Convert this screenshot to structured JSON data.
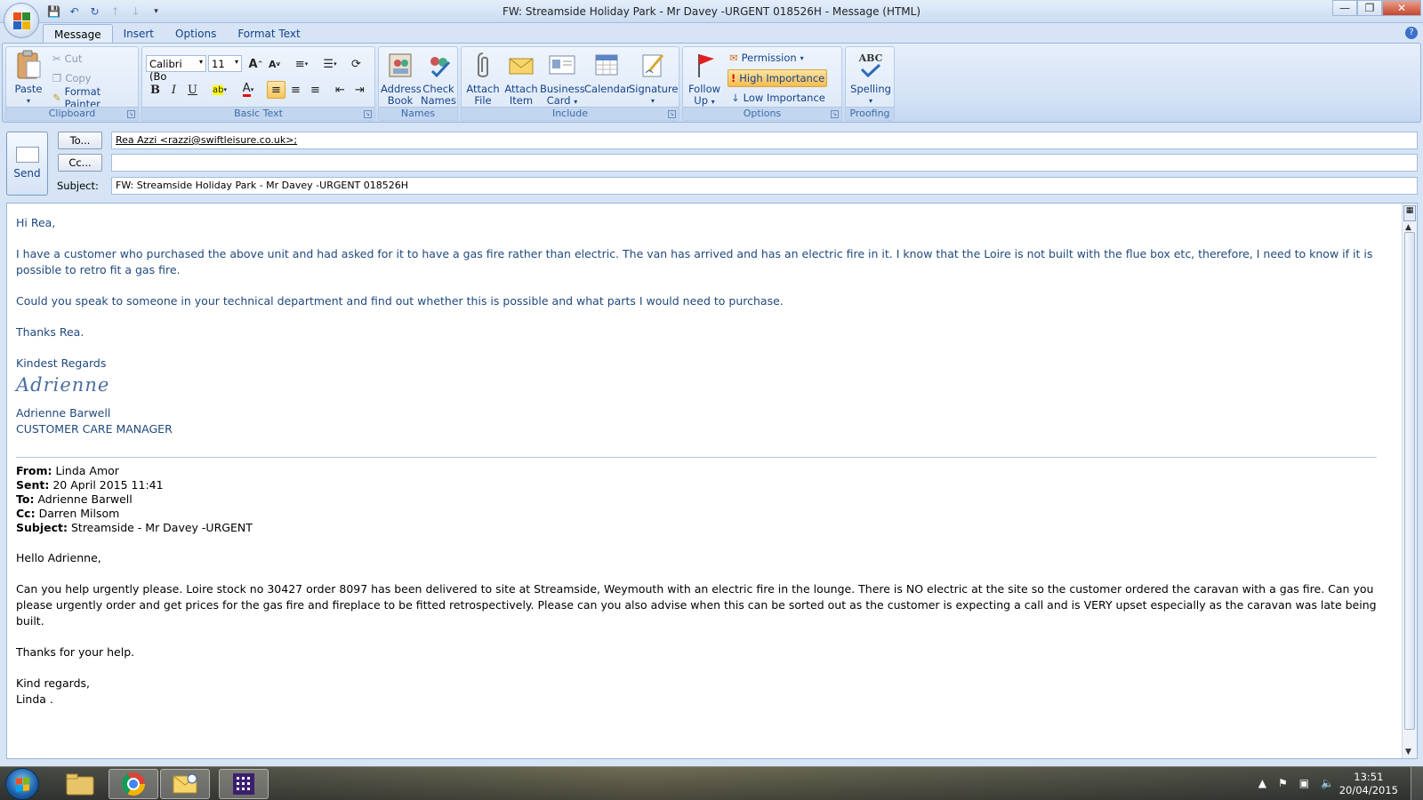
{
  "window": {
    "title": "FW: Streamside Holiday Park  - Mr Davey -URGENT 018526H - Message (HTML)"
  },
  "tabs": [
    "Message",
    "Insert",
    "Options",
    "Format Text"
  ],
  "ribbon": {
    "clipboard": {
      "label": "Clipboard",
      "paste": "Paste",
      "cut": "Cut",
      "copy": "Copy",
      "format_painter": "Format Painter"
    },
    "basic_text": {
      "label": "Basic Text",
      "font": "Calibri (Bo",
      "size": "11"
    },
    "names": {
      "label": "Names",
      "address_book": [
        "Address",
        "Book"
      ],
      "check_names": [
        "Check",
        "Names"
      ]
    },
    "include": {
      "label": "Include",
      "attach_file": [
        "Attach",
        "File"
      ],
      "attach_item": [
        "Attach",
        "Item"
      ],
      "business_card": [
        "Business",
        "Card"
      ],
      "calendar": "Calendar",
      "signature": "Signature"
    },
    "options": {
      "label": "Options",
      "follow_up": [
        "Follow",
        "Up"
      ],
      "permission": "Permission",
      "high_importance": "High Importance",
      "low_importance": "Low Importance"
    },
    "proofing": {
      "label": "Proofing",
      "spelling": "Spelling",
      "abc": "ABC"
    }
  },
  "header": {
    "send": "Send",
    "to_btn": "To...",
    "cc_btn": "Cc...",
    "subject_label": "Subject:",
    "to_value": "Rea Azzi <razzi@swiftleisure.co.uk>;",
    "cc_value": "",
    "subject_value": "FW: Streamside Holiday Park  - Mr Davey -URGENT 018526H"
  },
  "message": {
    "greeting": "Hi Rea,",
    "para1": "I have a customer who purchased the above unit and had asked for it to have a gas fire rather than electric.  The van has arrived and has an electric fire in it.  I know that the Loire is not built with the flue box etc, therefore, I need to know if it is possible to retro fit a gas fire.",
    "para2": "Could you speak to someone in your technical department and find out whether this is possible and what parts I would need to purchase.",
    "thanks": "Thanks Rea.",
    "regards": "Kindest Regards",
    "signature": "Adrienne",
    "sender_name": "Adrienne Barwell",
    "sender_title": "CUSTOMER CARE MANAGER"
  },
  "quoted": {
    "from_label": "From:",
    "from": "Linda Amor",
    "sent_label": "Sent:",
    "sent": "20 April 2015 11:41",
    "to_label": "To:",
    "to": "Adrienne Barwell",
    "cc_label": "Cc:",
    "cc": "Darren Milsom",
    "subject_label": "Subject:",
    "subject": "Streamside - Mr Davey -URGENT",
    "greeting": "Hello Adrienne,",
    "para1": "Can you help urgently please.  Loire stock no 30427 order 8097 has been delivered to site at Streamside, Weymouth with an electric fire in the lounge.  There is NO electric at the site so the customer ordered the caravan with a gas fire.  Can you please urgently order and get prices for the gas fire and fireplace to be fitted retrospectively.  Please can you also advise when this can be sorted out as the customer is expecting a call and is VERY upset especially as the caravan was late being built.",
    "thanks": "Thanks for your help.",
    "regards": "Kind regards,",
    "name": "Linda ."
  },
  "taskbar": {
    "time": "13:51",
    "date": "20/04/2015"
  },
  "colors": {
    "ribbon_blue": "#15428b",
    "body_text": "#1f497d",
    "high_importance": "#f5bd51"
  }
}
